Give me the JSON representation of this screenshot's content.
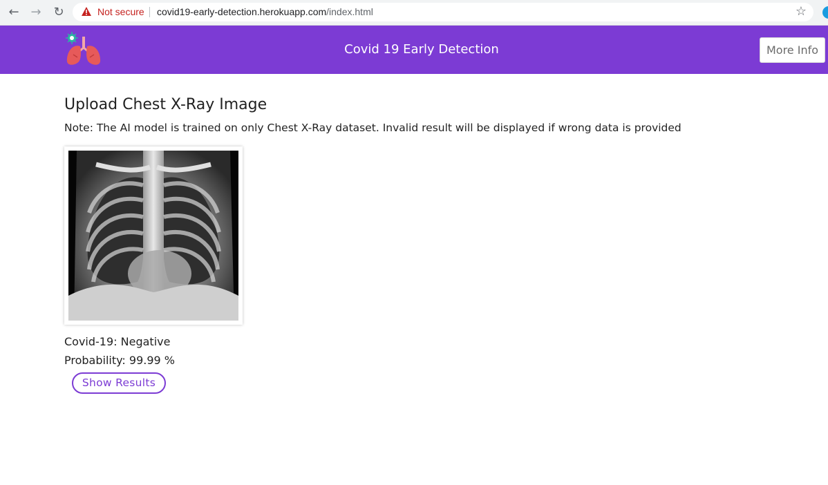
{
  "browser": {
    "security_label": "Not secure",
    "url_host": "covid19-early-detection.herokuapp.com",
    "url_path": "/index.html"
  },
  "header": {
    "title": "Covid 19 Early Detection",
    "more_info_label": "More Info",
    "brand_color": "#7c3bd4"
  },
  "main": {
    "heading": "Upload Chest X-Ray Image",
    "note": "Note: The AI model is trained on only Chest X-Ray dataset. Invalid result will be displayed if wrong data is provided",
    "result": {
      "covid_label": "Covid-19: Negative",
      "probability_label": "Probability: 99.99 %"
    },
    "show_results_label": "Show Results"
  }
}
